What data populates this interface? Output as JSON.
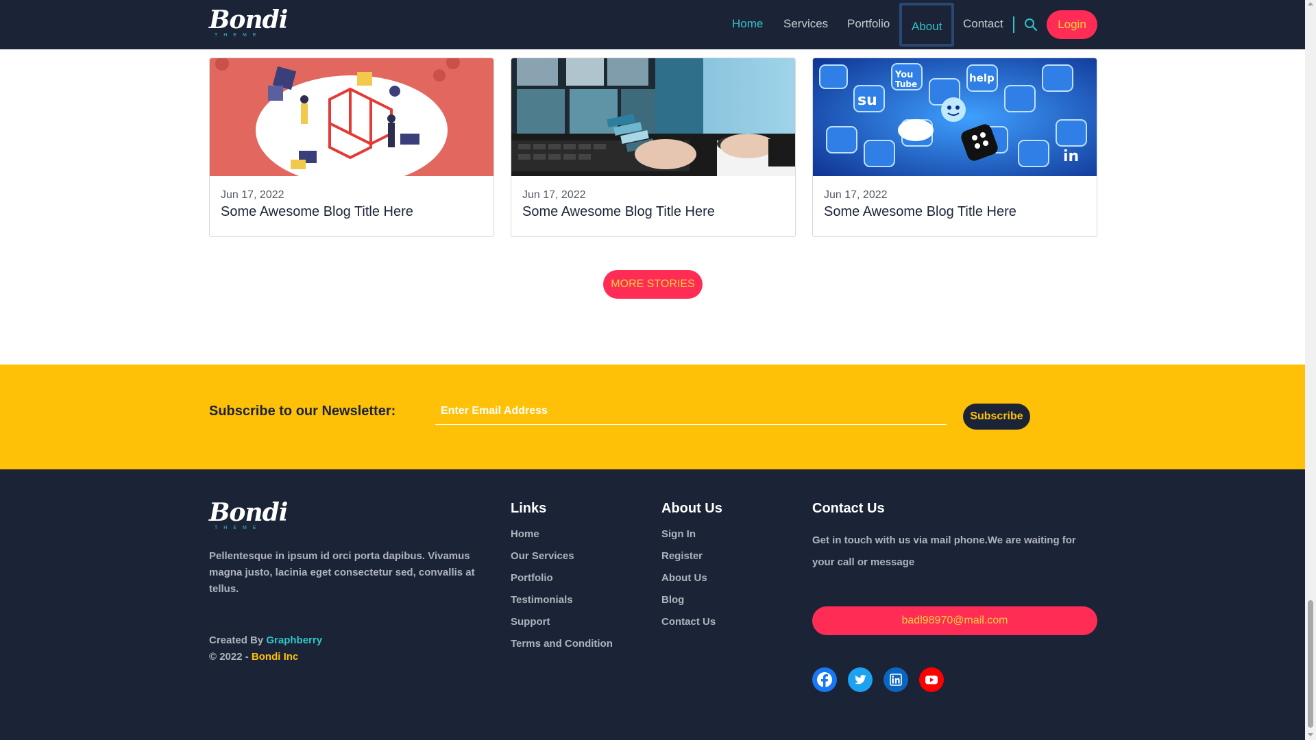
{
  "header": {
    "logo_word": "Bondi",
    "logo_sub": "THEME",
    "nav": [
      "Home",
      "Services",
      "Portfolio",
      "About",
      "Contact"
    ],
    "active_nav": "Home",
    "focused_nav": "About",
    "login_label": "Login"
  },
  "blog": {
    "cards": [
      {
        "date": "Jun 17, 2022",
        "title": "Some Awesome Blog Title Here",
        "image": "laravel-illustration"
      },
      {
        "date": "Jun 17, 2022",
        "title": "Some Awesome Blog Title Here",
        "image": "designer-color-swatches"
      },
      {
        "date": "Jun 17, 2022",
        "title": "Some Awesome Blog Title Here",
        "image": "social-media-icons"
      }
    ],
    "more_label": "MORE STORIES"
  },
  "newsletter": {
    "label": "Subscribe to our Newsletter:",
    "placeholder": "Enter Email Address",
    "button_label": "Subscribe"
  },
  "footer": {
    "logo_word": "Bondi",
    "logo_sub": "THEME",
    "description": "Pellentesque in ipsum id orci porta dapibus. Vivamus magna justo, lacinia eget consectetur sed, convallis at tellus.",
    "created_prefix": "Created By ",
    "created_by": "Graphberry",
    "copyright_prefix": "© 2022 - ",
    "company": "Bondi Inc",
    "links": {
      "heading": "Links",
      "items": [
        "Home",
        "Our Services",
        "Portfolio",
        "Testimonials",
        "Support",
        "Terms and Condition"
      ]
    },
    "about": {
      "heading": "About Us",
      "items": [
        "Sign In",
        "Register",
        "About Us",
        "Blog",
        "Contact Us"
      ]
    },
    "contact": {
      "heading": "Contact Us",
      "text": "Get in touch with us via mail phone.We are waiting for your call or message",
      "email": "badl98970@mail.com"
    },
    "social": [
      "facebook-icon",
      "twitter-icon",
      "linkedin-icon",
      "youtube-icon"
    ]
  },
  "colors": {
    "navy": "#1b2437",
    "teal": "#31c4c9",
    "pink": "#ff2d55",
    "yellow": "#ffc107"
  }
}
